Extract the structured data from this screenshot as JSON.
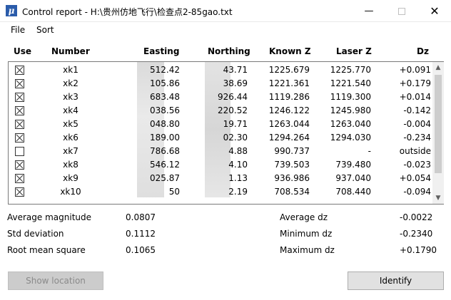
{
  "window": {
    "app_icon_glyph": "μ",
    "title": "Control report - H:\\贵州仿地飞行\\检查点2-85gao.txt",
    "minimize_glyph": "—",
    "close_glyph": "✕"
  },
  "menu": {
    "file": "File",
    "sort": "Sort"
  },
  "columns": {
    "use": "Use",
    "number": "Number",
    "easting": "Easting",
    "northing": "Northing",
    "known_z": "Known Z",
    "laser_z": "Laser Z",
    "dz": "Dz"
  },
  "rows": [
    {
      "use": true,
      "number": "xk1",
      "easting": "512.42",
      "northing": "43.71",
      "known_z": "1225.679",
      "laser_z": "1225.770",
      "dz": "+0.091"
    },
    {
      "use": true,
      "number": "xk2",
      "easting": "105.86",
      "northing": "38.69",
      "known_z": "1221.361",
      "laser_z": "1221.540",
      "dz": "+0.179"
    },
    {
      "use": true,
      "number": "xk3",
      "easting": "683.48",
      "northing": "926.44",
      "known_z": "1119.286",
      "laser_z": "1119.300",
      "dz": "+0.014"
    },
    {
      "use": true,
      "number": "xk4",
      "easting": "038.56",
      "northing": "220.52",
      "known_z": "1246.122",
      "laser_z": "1245.980",
      "dz": "-0.142"
    },
    {
      "use": true,
      "number": "xk5",
      "easting": "048.80",
      "northing": "19.71",
      "known_z": "1263.044",
      "laser_z": "1263.040",
      "dz": "-0.004"
    },
    {
      "use": true,
      "number": "xk6",
      "easting": "189.00",
      "northing": "02.30",
      "known_z": "1294.264",
      "laser_z": "1294.030",
      "dz": "-0.234"
    },
    {
      "use": false,
      "number": "xk7",
      "easting": "786.68",
      "northing": "4.88",
      "known_z": "990.737",
      "laser_z": "-",
      "dz": "outside"
    },
    {
      "use": true,
      "number": "xk8",
      "easting": "546.12",
      "northing": "4.10",
      "known_z": "739.503",
      "laser_z": "739.480",
      "dz": "-0.023"
    },
    {
      "use": true,
      "number": "xk9",
      "easting": "025.87",
      "northing": "1.13",
      "known_z": "936.986",
      "laser_z": "937.040",
      "dz": "+0.054"
    },
    {
      "use": true,
      "number": "xk10",
      "easting": "50",
      "northing": "2.19",
      "known_z": "708.534",
      "laser_z": "708.440",
      "dz": "-0.094"
    }
  ],
  "scrollbar": {
    "up_glyph": "▲",
    "down_glyph": "▼"
  },
  "stats": {
    "avg_magnitude_label": "Average magnitude",
    "avg_magnitude_value": "0.0807",
    "std_dev_label": "Std deviation",
    "std_dev_value": "0.1112",
    "rms_label": "Root mean square",
    "rms_value": "0.1065",
    "avg_dz_label": "Average dz",
    "avg_dz_value": "-0.0022",
    "min_dz_label": "Minimum dz",
    "min_dz_value": "-0.2340",
    "max_dz_label": "Maximum dz",
    "max_dz_value": "+0.1790"
  },
  "buttons": {
    "show_location": "Show location",
    "identify": "Identify"
  }
}
